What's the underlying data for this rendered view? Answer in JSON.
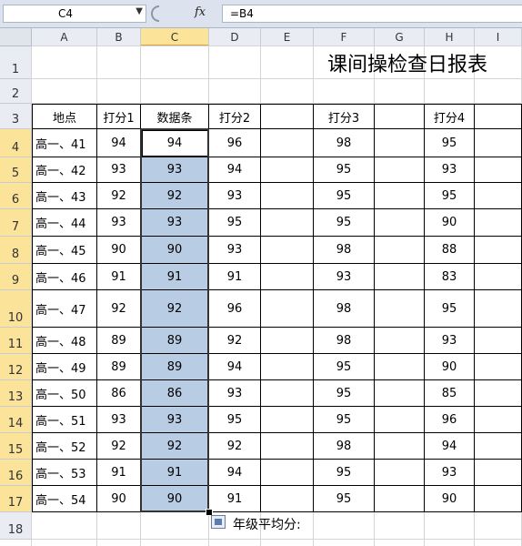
{
  "formula_bar": {
    "cell_ref": "C4",
    "fx": "fx",
    "formula": "=B4"
  },
  "columns": [
    "A",
    "B",
    "C",
    "D",
    "E",
    "F",
    "G",
    "H",
    "I"
  ],
  "rows": [
    "1",
    "2",
    "3",
    "4",
    "5",
    "6",
    "7",
    "8",
    "9",
    "10",
    "11",
    "12",
    "13",
    "14",
    "15",
    "16",
    "17",
    "18"
  ],
  "sheet": {
    "title": "课间操检查日报表",
    "headers": {
      "a": "地点",
      "b": "打分1",
      "c": "数据条",
      "d": "打分2",
      "f": "打分3",
      "h": "打分4"
    },
    "records": [
      {
        "place": "高一、41",
        "s1": "94",
        "bar": "94",
        "s2": "96",
        "s3": "98",
        "s4": "95"
      },
      {
        "place": "高一、42",
        "s1": "93",
        "bar": "93",
        "s2": "94",
        "s3": "95",
        "s4": "93"
      },
      {
        "place": "高一、43",
        "s1": "92",
        "bar": "92",
        "s2": "93",
        "s3": "95",
        "s4": "95"
      },
      {
        "place": "高一、44",
        "s1": "93",
        "bar": "93",
        "s2": "95",
        "s3": "95",
        "s4": "90"
      },
      {
        "place": "高一、45",
        "s1": "90",
        "bar": "90",
        "s2": "93",
        "s3": "98",
        "s4": "88"
      },
      {
        "place": "高一、46",
        "s1": "91",
        "bar": "91",
        "s2": "91",
        "s3": "93",
        "s4": "83"
      },
      {
        "place": "高一、47",
        "s1": "92",
        "bar": "92",
        "s2": "96",
        "s3": "98",
        "s4": "95"
      },
      {
        "place": "高一、48",
        "s1": "89",
        "bar": "89",
        "s2": "92",
        "s3": "98",
        "s4": "93"
      },
      {
        "place": "高一、49",
        "s1": "89",
        "bar": "89",
        "s2": "94",
        "s3": "95",
        "s4": "90"
      },
      {
        "place": "高一、50",
        "s1": "86",
        "bar": "86",
        "s2": "93",
        "s3": "95",
        "s4": "85"
      },
      {
        "place": "高一、51",
        "s1": "93",
        "bar": "93",
        "s2": "95",
        "s3": "95",
        "s4": "96"
      },
      {
        "place": "高一、52",
        "s1": "92",
        "bar": "92",
        "s2": "92",
        "s3": "98",
        "s4": "94"
      },
      {
        "place": "高一、53",
        "s1": "91",
        "bar": "91",
        "s2": "94",
        "s3": "95",
        "s4": "93"
      },
      {
        "place": "高一、54",
        "s1": "90",
        "bar": "90",
        "s2": "91",
        "s3": "95",
        "s4": "90"
      }
    ],
    "average_label": "年级平均分:"
  },
  "colors": {
    "selection_fill": "#b8cce4",
    "header_selected": "#fbe39a"
  }
}
